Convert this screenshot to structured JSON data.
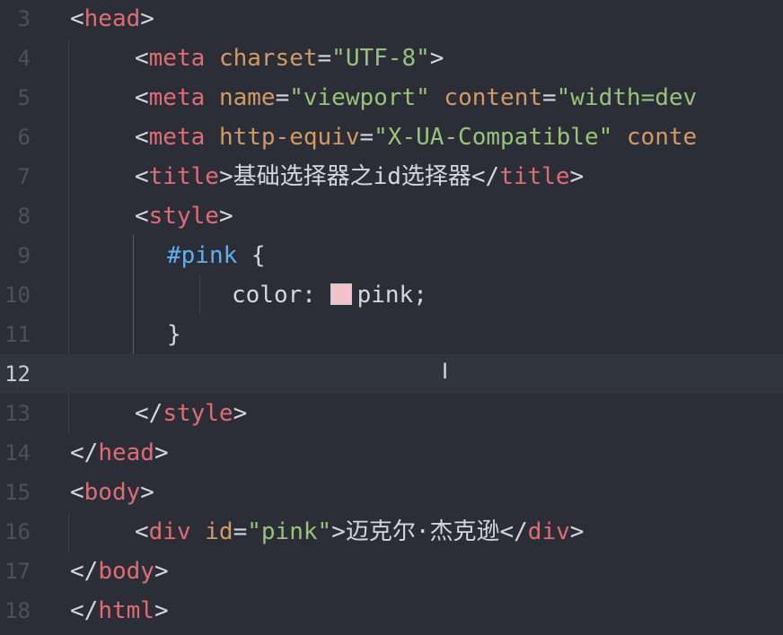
{
  "editor": {
    "lines": [
      {
        "number": "3",
        "tokens": [
          {
            "t": "<",
            "c": "punc"
          },
          {
            "t": "head",
            "c": "tag"
          },
          {
            "t": ">",
            "c": "punc"
          }
        ],
        "indent": 0
      },
      {
        "number": "4",
        "tokens": [
          {
            "t": "<",
            "c": "punc"
          },
          {
            "t": "meta",
            "c": "tag"
          },
          {
            "t": " ",
            "c": "punc"
          },
          {
            "t": "charset",
            "c": "attr"
          },
          {
            "t": "=",
            "c": "punc"
          },
          {
            "t": "\"UTF-8\"",
            "c": "str"
          },
          {
            "t": ">",
            "c": "punc"
          }
        ],
        "indent": 1
      },
      {
        "number": "5",
        "tokens": [
          {
            "t": "<",
            "c": "punc"
          },
          {
            "t": "meta",
            "c": "tag"
          },
          {
            "t": " ",
            "c": "punc"
          },
          {
            "t": "name",
            "c": "attr"
          },
          {
            "t": "=",
            "c": "punc"
          },
          {
            "t": "\"viewport\"",
            "c": "str"
          },
          {
            "t": " ",
            "c": "punc"
          },
          {
            "t": "content",
            "c": "attr"
          },
          {
            "t": "=",
            "c": "punc"
          },
          {
            "t": "\"width=dev",
            "c": "str"
          }
        ],
        "indent": 1
      },
      {
        "number": "6",
        "tokens": [
          {
            "t": "<",
            "c": "punc"
          },
          {
            "t": "meta",
            "c": "tag"
          },
          {
            "t": " ",
            "c": "punc"
          },
          {
            "t": "http-equiv",
            "c": "attr"
          },
          {
            "t": "=",
            "c": "punc"
          },
          {
            "t": "\"X-UA-Compatible\"",
            "c": "str"
          },
          {
            "t": " ",
            "c": "punc"
          },
          {
            "t": "conte",
            "c": "attr"
          }
        ],
        "indent": 1
      },
      {
        "number": "7",
        "tokens": [
          {
            "t": "<",
            "c": "punc"
          },
          {
            "t": "title",
            "c": "tag"
          },
          {
            "t": ">",
            "c": "punc"
          },
          {
            "t": "基础选择器之id选择器",
            "c": "text"
          },
          {
            "t": "</",
            "c": "punc"
          },
          {
            "t": "title",
            "c": "tag"
          },
          {
            "t": ">",
            "c": "punc"
          }
        ],
        "indent": 1
      },
      {
        "number": "8",
        "tokens": [
          {
            "t": "<",
            "c": "punc"
          },
          {
            "t": "style",
            "c": "tag"
          },
          {
            "t": ">",
            "c": "punc"
          }
        ],
        "indent": 1
      },
      {
        "number": "9",
        "tokens": [
          {
            "t": "#pink",
            "c": "sel"
          },
          {
            "t": " {",
            "c": "punc"
          }
        ],
        "indent": 1.5
      },
      {
        "number": "10",
        "tokens": [
          {
            "t": "color",
            "c": "prop"
          },
          {
            "t": ": ",
            "c": "punc"
          },
          {
            "swatch": "#f4c2cb"
          },
          {
            "t": "pink",
            "c": "val"
          },
          {
            "t": ";",
            "c": "punc"
          }
        ],
        "indent": 2.5
      },
      {
        "number": "11",
        "tokens": [
          {
            "t": "}",
            "c": "punc"
          }
        ],
        "indent": 1.5
      },
      {
        "number": "12",
        "tokens": [],
        "indent": 0,
        "active": true
      },
      {
        "number": "13",
        "tokens": [
          {
            "t": "</",
            "c": "punc"
          },
          {
            "t": "style",
            "c": "tag"
          },
          {
            "t": ">",
            "c": "punc"
          }
        ],
        "indent": 1
      },
      {
        "number": "14",
        "tokens": [
          {
            "t": "</",
            "c": "punc"
          },
          {
            "t": "head",
            "c": "tag"
          },
          {
            "t": ">",
            "c": "punc"
          }
        ],
        "indent": 0
      },
      {
        "number": "15",
        "tokens": [
          {
            "t": "<",
            "c": "punc"
          },
          {
            "t": "body",
            "c": "tag"
          },
          {
            "t": ">",
            "c": "punc"
          }
        ],
        "indent": 0
      },
      {
        "number": "16",
        "tokens": [
          {
            "t": "<",
            "c": "punc"
          },
          {
            "t": "div",
            "c": "tag"
          },
          {
            "t": " ",
            "c": "punc"
          },
          {
            "t": "id",
            "c": "attr"
          },
          {
            "t": "=",
            "c": "punc"
          },
          {
            "t": "\"pink\"",
            "c": "str"
          },
          {
            "t": ">",
            "c": "punc"
          },
          {
            "t": "迈克尔·杰克逊",
            "c": "text"
          },
          {
            "t": "</",
            "c": "punc"
          },
          {
            "t": "div",
            "c": "tag"
          },
          {
            "t": ">",
            "c": "punc"
          }
        ],
        "indent": 1
      },
      {
        "number": "17",
        "tokens": [
          {
            "t": "</",
            "c": "punc"
          },
          {
            "t": "body",
            "c": "tag"
          },
          {
            "t": ">",
            "c": "punc"
          }
        ],
        "indent": 0
      },
      {
        "number": "18",
        "tokens": [
          {
            "t": "</",
            "c": "punc"
          },
          {
            "t": "html",
            "c": "tag"
          },
          {
            "t": ">",
            "c": "punc"
          }
        ],
        "indent": 0
      }
    ]
  },
  "colors": {
    "background": "#2b2e36",
    "active_line": "#31353d",
    "tag": "#e06c75",
    "attribute": "#d19a66",
    "string": "#98c379",
    "selector": "#61afef",
    "text": "#d4d7dd",
    "line_number": "#4c515b",
    "pink_swatch": "#f4c2cb"
  },
  "icons": {
    "cursor": "text-cursor-ibeam-icon",
    "swatch": "color-swatch-icon"
  }
}
